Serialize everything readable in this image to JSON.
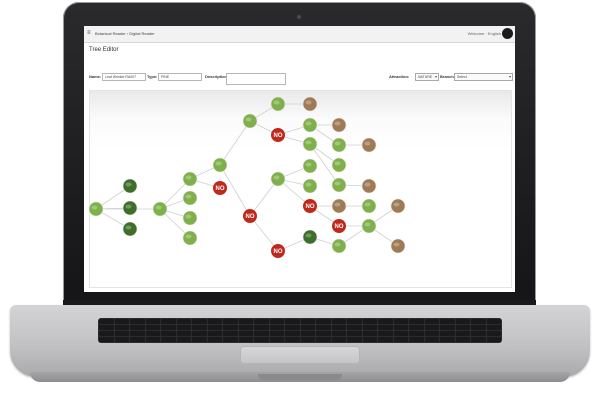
{
  "app": {
    "menu_icon": "hamburger-icon",
    "breadcrumb": "Botanical Reader › Digital Reader",
    "user_label": "Welcome · English",
    "page_title": "Tree Editor"
  },
  "form": {
    "name_label": "Name:",
    "name_value": "Leaf Wrinkle RA007",
    "type_label": "Type:",
    "type_value": "PINE",
    "description_label": "Description:",
    "description_value": "",
    "attraction_label": "Attraction:",
    "attraction_value": "NATURE",
    "branch_label": "Branch:",
    "branch_value": "Select"
  },
  "tree": {
    "no_label": "NO",
    "colors": {
      "no_node": "#c0281c",
      "edge": "#cfcfcf",
      "leaf_light": "#7fb04a",
      "leaf_dark": "#3f6e2a",
      "bark": "#9e7a55"
    }
  }
}
